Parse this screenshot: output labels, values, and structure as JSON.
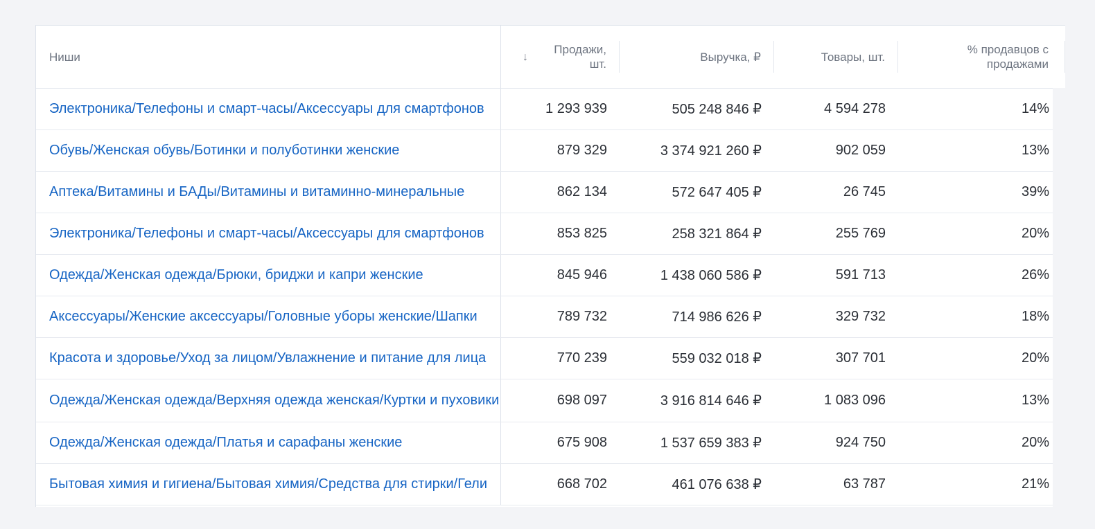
{
  "table": {
    "headers": {
      "niche": "Ниши",
      "sales": "Продажи, шт.",
      "revenue": "Выручка, ₽",
      "goods": "Товары, шт.",
      "sellers_pct": "% продавцов с продажами"
    },
    "sort": {
      "column": "sales",
      "direction": "desc",
      "icon": "arrow-down-icon",
      "glyph": "↓"
    },
    "rows": [
      {
        "niche": "Электроника/Телефоны и смарт-часы/Аксессуары для смартфонов",
        "sales": "1 293 939",
        "revenue": "505 248 846 ₽",
        "goods": "4 594 278",
        "pct": "14%"
      },
      {
        "niche": "Обувь/Женская обувь/Ботинки и полуботинки женские",
        "sales": "879 329",
        "revenue": "3 374 921 260 ₽",
        "goods": "902 059",
        "pct": "13%"
      },
      {
        "niche": "Аптека/Витамины и БАДы/Витамины и витаминно-минеральные",
        "sales": "862 134",
        "revenue": "572 647 405 ₽",
        "goods": "26 745",
        "pct": "39%"
      },
      {
        "niche": "Электроника/Телефоны и смарт-часы/Аксессуары для смартфонов",
        "sales": "853 825",
        "revenue": "258 321 864 ₽",
        "goods": "255 769",
        "pct": "20%"
      },
      {
        "niche": "Одежда/Женская одежда/Брюки, бриджи и капри женские",
        "sales": "845 946",
        "revenue": "1 438 060 586 ₽",
        "goods": "591 713",
        "pct": "26%"
      },
      {
        "niche": "Аксессуары/Женские аксессуары/Головные уборы женские/Шапки",
        "sales": "789 732",
        "revenue": "714 986 626 ₽",
        "goods": "329 732",
        "pct": "18%"
      },
      {
        "niche": "Красота и здоровье/Уход за лицом/Увлажнение и питание для лица",
        "sales": "770 239",
        "revenue": "559 032 018 ₽",
        "goods": "307 701",
        "pct": "20%"
      },
      {
        "niche": "Одежда/Женская одежда/Верхняя одежда женская/Куртки и пуховики",
        "sales": "698 097",
        "revenue": "3 916 814 646 ₽",
        "goods": "1 083 096",
        "pct": "13%"
      },
      {
        "niche": "Одежда/Женская одежда/Платья и сарафаны женские",
        "sales": "675 908",
        "revenue": "1 537 659 383 ₽",
        "goods": "924 750",
        "pct": "20%"
      },
      {
        "niche": "Бытовая химия и гигиена/Бытовая химия/Средства для стирки/Гели",
        "sales": "668 702",
        "revenue": "461 076 638 ₽",
        "goods": "63 787",
        "pct": "21%"
      }
    ]
  }
}
